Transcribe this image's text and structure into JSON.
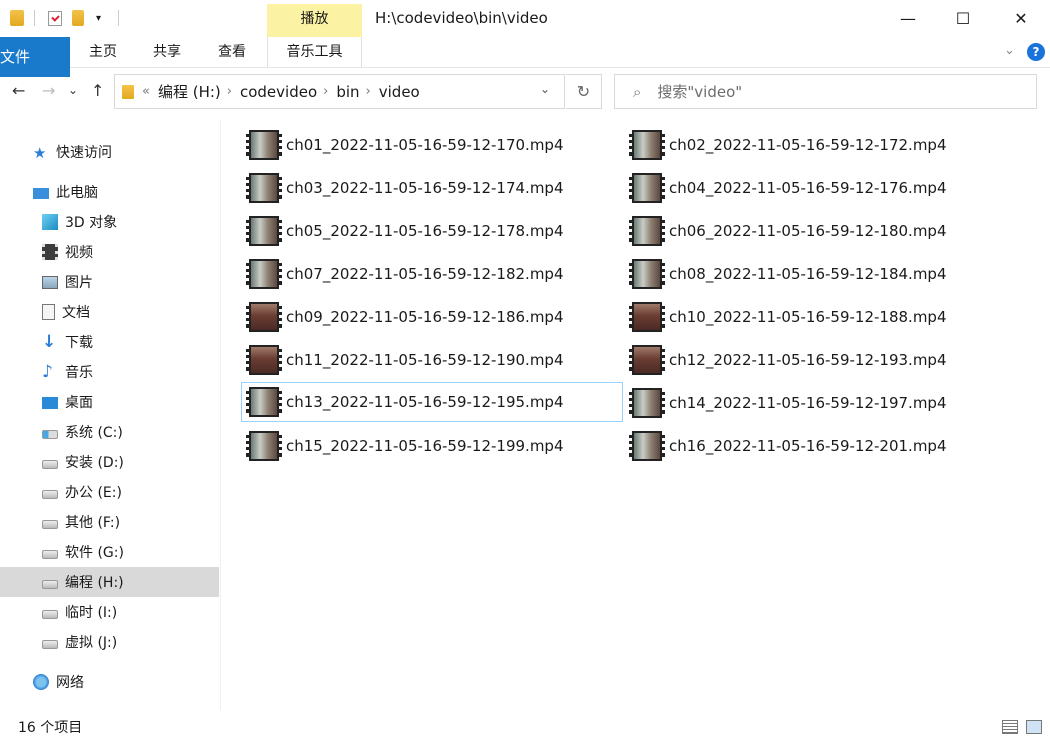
{
  "titlebar": {
    "path": "H:\\codevideo\\bin\\video",
    "context_tab": "播放",
    "minimize": "—",
    "maximize": "☐",
    "close": "✕"
  },
  "ribbon": {
    "tabs": [
      "文件",
      "主页",
      "共享",
      "查看",
      "音乐工具"
    ],
    "expand_icon": "chevron-down-icon",
    "help": "?"
  },
  "nav": {
    "back": "←",
    "forward": "→",
    "recent": "⌄",
    "up": "↑",
    "overflow": "«",
    "breadcrumb": [
      "编程 (H:)",
      "codevideo",
      "bin",
      "video"
    ],
    "refresh": "↻"
  },
  "search": {
    "placeholder": "搜索\"video\""
  },
  "sidebar": {
    "quick_access": "快速访问",
    "this_pc": "此电脑",
    "items": [
      "3D 对象",
      "视频",
      "图片",
      "文档",
      "下载",
      "音乐",
      "桌面"
    ],
    "drives": [
      "系统 (C:)",
      "安装 (D:)",
      "办公 (E:)",
      "其他 (F:)",
      "软件 (G:)",
      "编程 (H:)",
      "临时 (I:)",
      "虚拟 (J:)"
    ],
    "network": "网络"
  },
  "files": [
    "ch01_2022-11-05-16-59-12-170.mp4",
    "ch02_2022-11-05-16-59-12-172.mp4",
    "ch03_2022-11-05-16-59-12-174.mp4",
    "ch04_2022-11-05-16-59-12-176.mp4",
    "ch05_2022-11-05-16-59-12-178.mp4",
    "ch06_2022-11-05-16-59-12-180.mp4",
    "ch07_2022-11-05-16-59-12-182.mp4",
    "ch08_2022-11-05-16-59-12-184.mp4",
    "ch09_2022-11-05-16-59-12-186.mp4",
    "ch10_2022-11-05-16-59-12-188.mp4",
    "ch11_2022-11-05-16-59-12-190.mp4",
    "ch12_2022-11-05-16-59-12-193.mp4",
    "ch13_2022-11-05-16-59-12-195.mp4",
    "ch14_2022-11-05-16-59-12-197.mp4",
    "ch15_2022-11-05-16-59-12-199.mp4",
    "ch16_2022-11-05-16-59-12-201.mp4"
  ],
  "status": {
    "count": "16 个项目"
  },
  "colors": {
    "accent": "#1979ca",
    "context_tab": "#fbf2a3",
    "selection": "#99d1ff"
  }
}
